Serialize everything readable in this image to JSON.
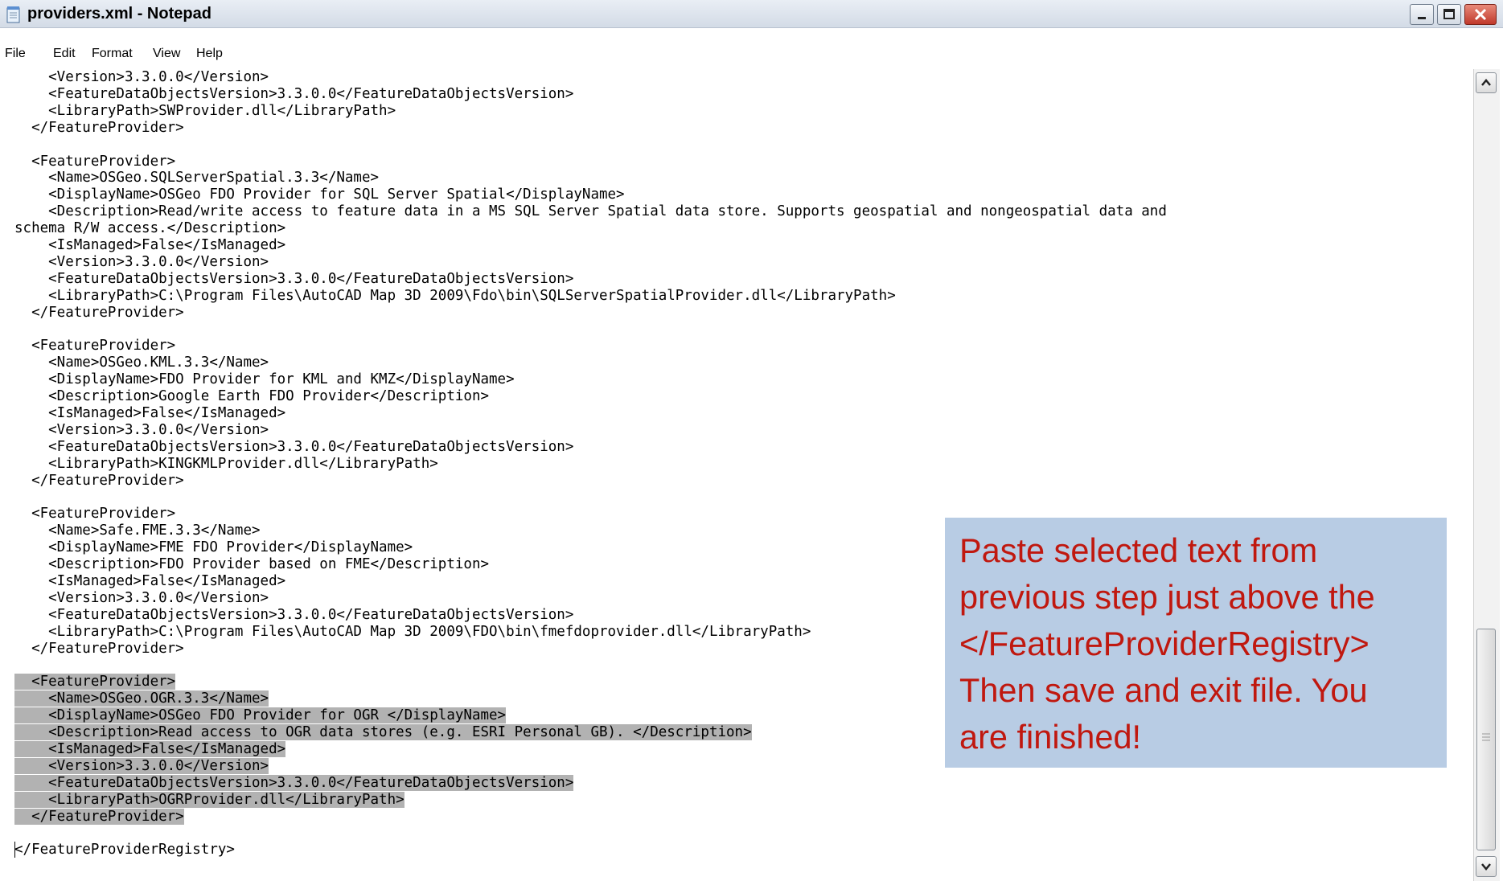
{
  "window": {
    "title": "providers.xml - Notepad",
    "app_icon": "notepad-icon",
    "controls": {
      "minimize": "minimize-icon",
      "maximize": "maximize-icon",
      "close": "close-icon"
    }
  },
  "menu": [
    "File",
    "Edit",
    "Format",
    "View",
    "Help"
  ],
  "editor": {
    "lines": [
      "    <Version>3.3.0.0</Version>",
      "    <FeatureDataObjectsVersion>3.3.0.0</FeatureDataObjectsVersion>",
      "    <LibraryPath>SWProvider.dll</LibraryPath>",
      "  </FeatureProvider>",
      "",
      "  <FeatureProvider>",
      "    <Name>OSGeo.SQLServerSpatial.3.3</Name>",
      "    <DisplayName>OSGeo FDO Provider for SQL Server Spatial</DisplayName>",
      "    <Description>Read/write access to feature data in a MS SQL Server Spatial data store. Supports geospatial and nongeospatial data and",
      "schema R/W access.</Description>",
      "    <IsManaged>False</IsManaged>",
      "    <Version>3.3.0.0</Version>",
      "    <FeatureDataObjectsVersion>3.3.0.0</FeatureDataObjectsVersion>",
      "    <LibraryPath>C:\\Program Files\\AutoCAD Map 3D 2009\\Fdo\\bin\\SQLServerSpatialProvider.dll</LibraryPath>",
      "  </FeatureProvider>",
      "",
      "  <FeatureProvider>",
      "    <Name>OSGeo.KML.3.3</Name>",
      "    <DisplayName>FDO Provider for KML and KMZ</DisplayName>",
      "    <Description>Google Earth FDO Provider</Description>",
      "    <IsManaged>False</IsManaged>",
      "    <Version>3.3.0.0</Version>",
      "    <FeatureDataObjectsVersion>3.3.0.0</FeatureDataObjectsVersion>",
      "    <LibraryPath>KINGKMLProvider.dll</LibraryPath>",
      "  </FeatureProvider>",
      "",
      "  <FeatureProvider>",
      "    <Name>Safe.FME.3.3</Name>",
      "    <DisplayName>FME FDO Provider</DisplayName>",
      "    <Description>FDO Provider based on FME</Description>",
      "    <IsManaged>False</IsManaged>",
      "    <Version>3.3.0.0</Version>",
      "    <FeatureDataObjectsVersion>3.3.0.0</FeatureDataObjectsVersion>",
      "    <LibraryPath>C:\\Program Files\\AutoCAD Map 3D 2009\\FDO\\bin\\fmefdoprovider.dll</LibraryPath>",
      "  </FeatureProvider>",
      "",
      "  <FeatureProvider>",
      "    <Name>OSGeo.OGR.3.3</Name>",
      "    <DisplayName>OSGeo FDO Provider for OGR </DisplayName>",
      "    <Description>Read access to OGR data stores (e.g. ESRI Personal GB). </Description>",
      "    <IsManaged>False</IsManaged>",
      "    <Version>3.3.0.0</Version>",
      "    <FeatureDataObjectsVersion>3.3.0.0</FeatureDataObjectsVersion>",
      "    <LibraryPath>OGRProvider.dll</LibraryPath>",
      "  </FeatureProvider>",
      "",
      "</FeatureProviderRegistry>"
    ],
    "selected_lines": [
      36,
      37,
      38,
      39,
      40,
      41,
      42,
      43,
      44
    ]
  },
  "callout": {
    "text": "Paste selected text from\nprevious step just above the\n</FeatureProviderRegistry>\nThen save and exit file. You\nare finished!",
    "bg_color": "#b8cce4",
    "text_color": "#c0180f"
  },
  "scrollbar": {
    "up": "scroll-up-icon",
    "down": "scroll-down-icon",
    "grip": "grip-icon"
  }
}
